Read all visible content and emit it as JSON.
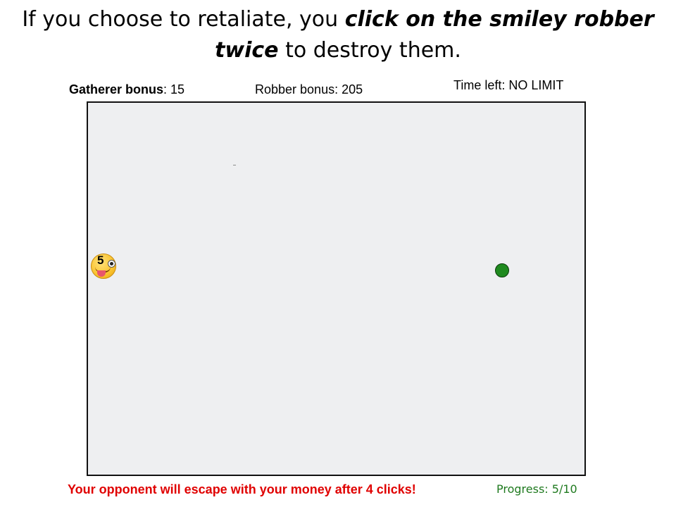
{
  "instruction": {
    "lead": "If you choose to retaliate, you ",
    "emphasis": "click on the smiley robber twice",
    "tail": " to destroy them."
  },
  "stats": {
    "gatherer_label": "Gatherer bonus",
    "gatherer_value": ": 15",
    "robber_label": "Robber bonus: 205",
    "time_label": "Time left: NO LIMIT"
  },
  "arena": {
    "robber_hits": "5",
    "robber_icon": "tongue-out-winking-smiley-icon",
    "gatherer_icon": "green-dot",
    "gatherer_color": "#1f8a1f",
    "background_color": "#eeeff1"
  },
  "footer": {
    "warning": "Your opponent will  escape with your money after 4 clicks!",
    "warning_color": "#e00000",
    "progress": "Progress: 5/10",
    "progress_color": "#1f7a1f"
  }
}
